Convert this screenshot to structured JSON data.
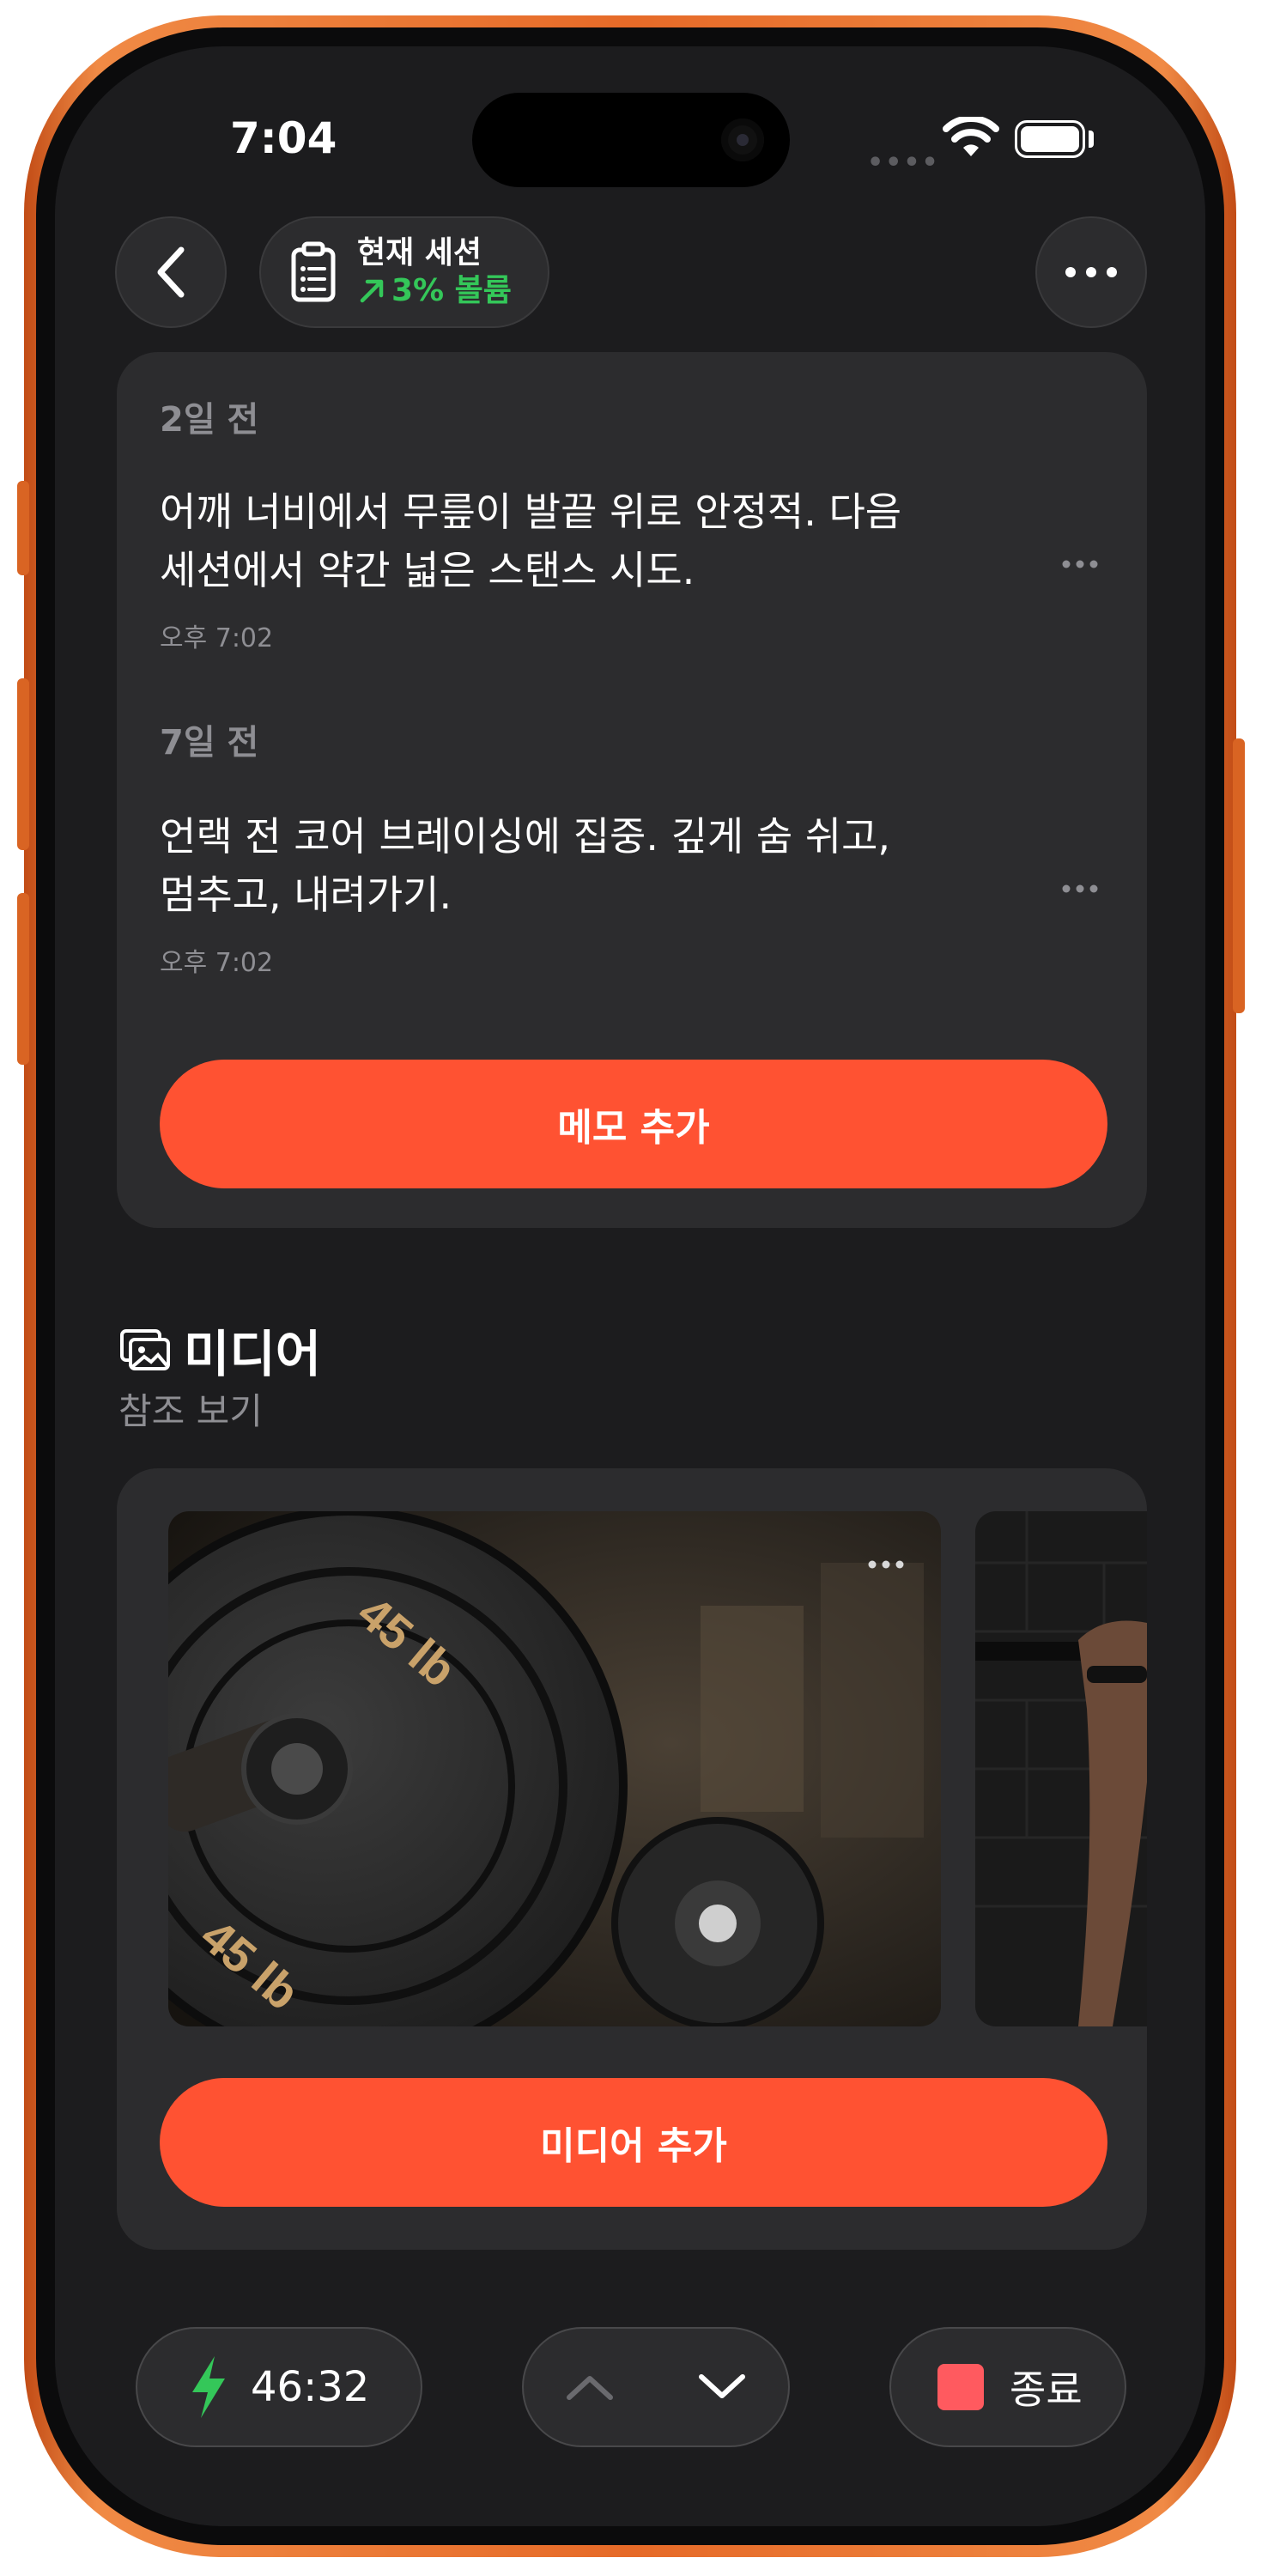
{
  "status_bar": {
    "time": "7:04",
    "signal_dots": "••••"
  },
  "nav": {
    "back_icon": "chevron-left-icon",
    "session_title": "현재 세션",
    "session_stat": "3% 볼륨",
    "session_stat_color": "#34c759",
    "more_icon": "ellipsis-icon"
  },
  "notes": [
    {
      "date": "2일 전",
      "text_line1": "어깨 너비에서 무릎이 발끝 위로 안정적. 다음",
      "text_line2": "세션에서 약간 넓은 스탠스 시도.",
      "time": "오후 7:02"
    },
    {
      "date": "7일 전",
      "text_line1": "언랙 전 코어 브레이싱에 집중. 깊게 숨 쉬고,",
      "text_line2": "멈추고, 내려가기.",
      "time": "오후 7:02"
    }
  ],
  "add_note_label": "메모 추가",
  "media": {
    "title": "미디어",
    "subtitle": "참조 보기",
    "add_label": "미디어 추가",
    "plate_text": "45 lb"
  },
  "bottom_bar": {
    "timer": "46:32",
    "end_label": "종료"
  },
  "colors": {
    "accent": "#ff5232",
    "background": "#1c1c1e",
    "card": "#2c2c2e"
  }
}
